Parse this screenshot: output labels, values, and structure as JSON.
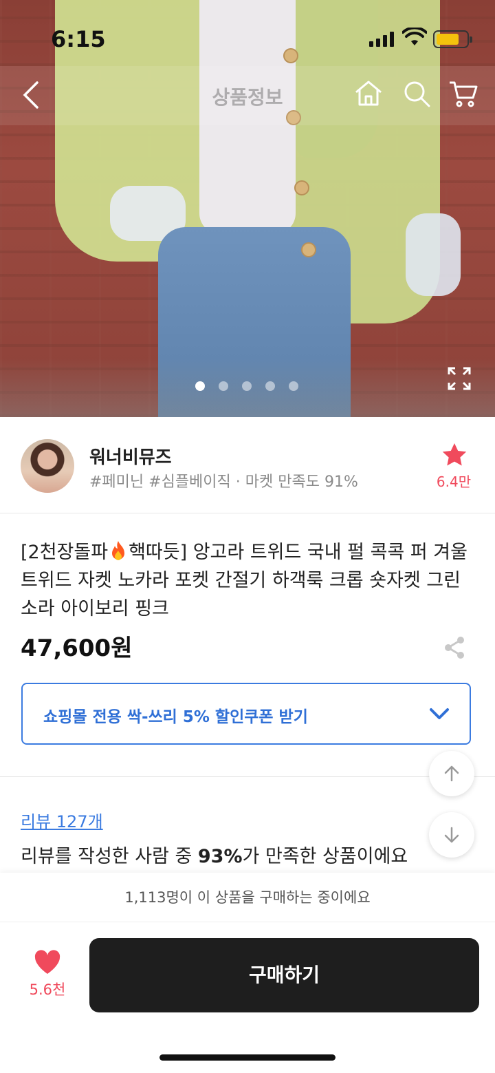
{
  "status_bar": {
    "time": "6:15"
  },
  "nav": {
    "title": "상품정보"
  },
  "hero": {
    "image_count": 5,
    "active_index": 1
  },
  "seller": {
    "name": "워너비뮤즈",
    "tags": "#페미닌 #심플베이직 · 마켓 만족도 91%",
    "favorite_count": "6.4만"
  },
  "product": {
    "title_part1": "[2천장돌파",
    "title_part2": "핵따듯] 앙고라 트위드 국내 펄 콕콕 퍼 겨울 트위드 자켓 노카라 포켓 간절기 하객룩 크롭 숏자켓 그린 소라 아이보리 핑크",
    "price": "47,600원"
  },
  "coupon": {
    "label": "쇼핑몰 전용 싹-쓰리 5% 할인쿠폰 받기"
  },
  "reviews": {
    "link": "리뷰 127개",
    "summary_prefix": "리뷰를 작성한 사람 중 ",
    "summary_percent": "93%",
    "summary_suffix": "가 만족한 상품이에요"
  },
  "bottom": {
    "buyers_text": "1,113명이 이 상품을 구매하는 중이에요",
    "like_count": "5.6천",
    "buy_label": "구매하기"
  },
  "colors": {
    "accent_blue": "#3b7be0",
    "like_red": "#f04a5c",
    "buy_black": "#1e1e1e"
  }
}
